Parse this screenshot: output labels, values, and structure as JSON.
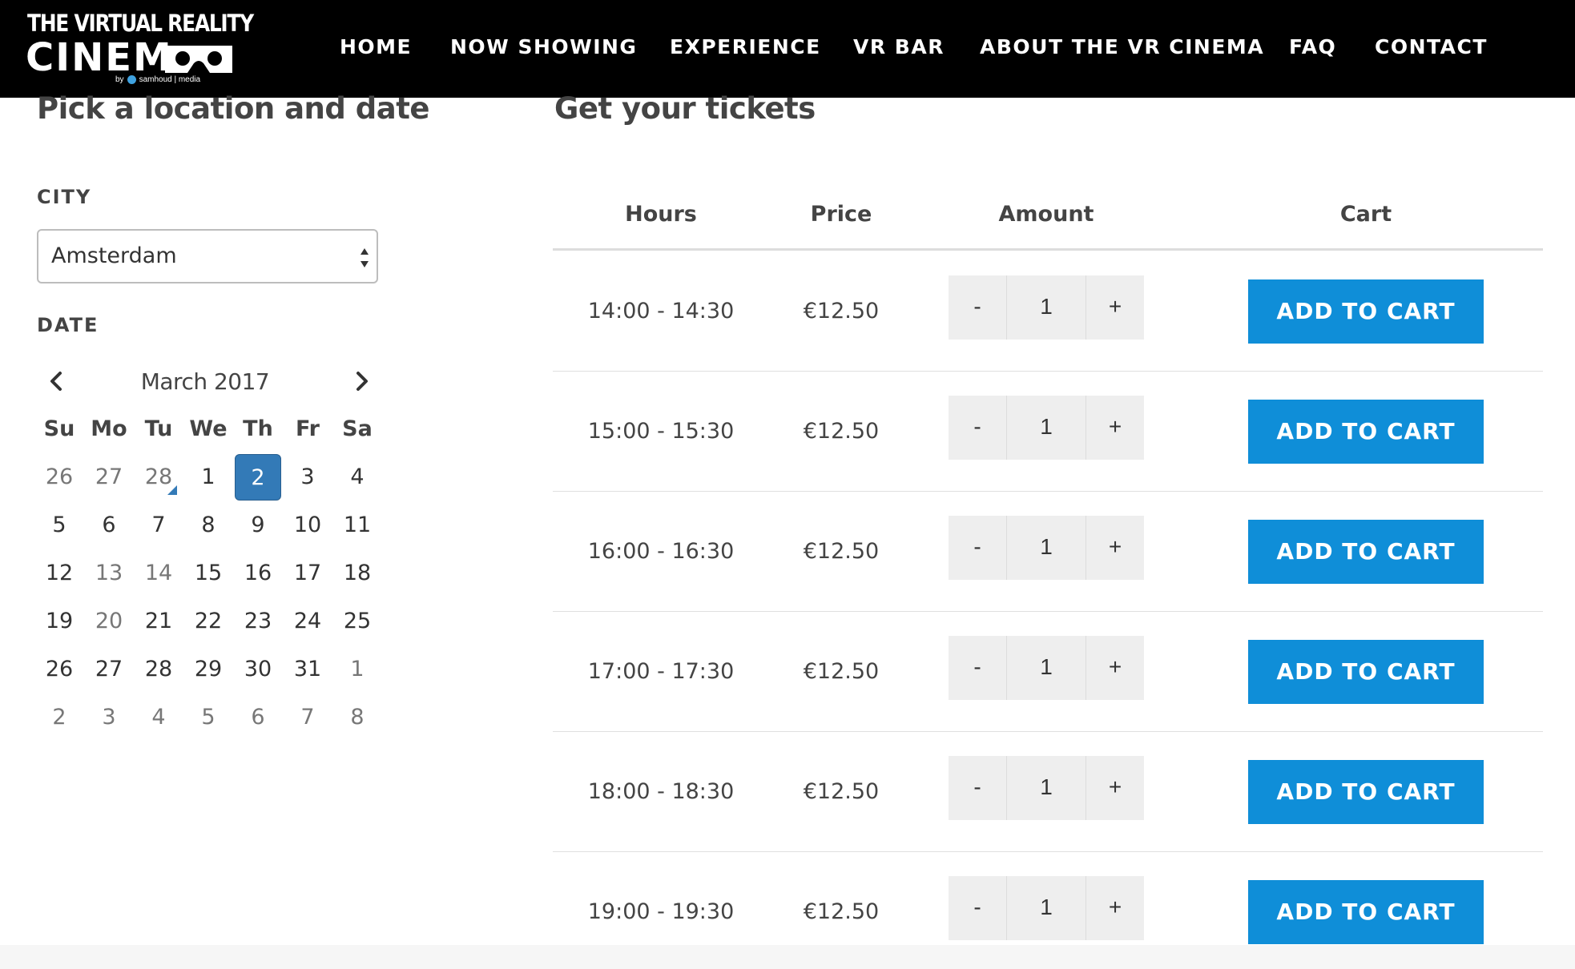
{
  "header": {
    "logo": {
      "line1": "THE VIRTUAL REALITY",
      "line2": "CINEM",
      "by": "by",
      "brand": "samhoud | media"
    },
    "nav": [
      "HOME",
      "NOW SHOWING",
      "EXPERIENCE",
      "VR BAR",
      "ABOUT THE VR CINEMA",
      "FAQ",
      "CONTACT"
    ]
  },
  "left": {
    "title": "Pick a location and date",
    "city_label": "CITY",
    "city_value": "Amsterdam",
    "date_label": "DATE",
    "calendar": {
      "month": "March 2017",
      "weekdays": [
        "Su",
        "Mo",
        "Tu",
        "We",
        "Th",
        "Fr",
        "Sa"
      ],
      "weeks": [
        [
          "26",
          "27",
          "28",
          "1",
          "2",
          "3",
          "4"
        ],
        [
          "5",
          "6",
          "7",
          "8",
          "9",
          "10",
          "11"
        ],
        [
          "12",
          "13",
          "14",
          "15",
          "16",
          "17",
          "18"
        ],
        [
          "19",
          "20",
          "21",
          "22",
          "23",
          "24",
          "25"
        ],
        [
          "26",
          "27",
          "28",
          "29",
          "30",
          "31",
          "1"
        ],
        [
          "2",
          "3",
          "4",
          "5",
          "6",
          "7",
          "8"
        ]
      ],
      "selected": "2",
      "today": "28"
    }
  },
  "right": {
    "title": "Get your tickets",
    "columns": [
      "Hours",
      "Price",
      "Amount",
      "Cart"
    ],
    "rows": [
      {
        "hours": "14:00 - 14:30",
        "price": "€12.50",
        "amount": "1",
        "minus": "-",
        "plus": "+",
        "cart": "ADD TO CART"
      },
      {
        "hours": "15:00 - 15:30",
        "price": "€12.50",
        "amount": "1",
        "minus": "-",
        "plus": "+",
        "cart": "ADD TO CART"
      },
      {
        "hours": "16:00 - 16:30",
        "price": "€12.50",
        "amount": "1",
        "minus": "-",
        "plus": "+",
        "cart": "ADD TO CART"
      },
      {
        "hours": "17:00 - 17:30",
        "price": "€12.50",
        "amount": "1",
        "minus": "-",
        "plus": "+",
        "cart": "ADD TO CART"
      },
      {
        "hours": "18:00 - 18:30",
        "price": "€12.50",
        "amount": "1",
        "minus": "-",
        "plus": "+",
        "cart": "ADD TO CART"
      },
      {
        "hours": "19:00 - 19:30",
        "price": "€12.50",
        "amount": "1",
        "minus": "-",
        "plus": "+",
        "cart": "ADD TO CART"
      }
    ]
  },
  "colors": {
    "accent": "#0f8ed8",
    "selected_day": "#337ab7",
    "header_bg": "#000000"
  }
}
